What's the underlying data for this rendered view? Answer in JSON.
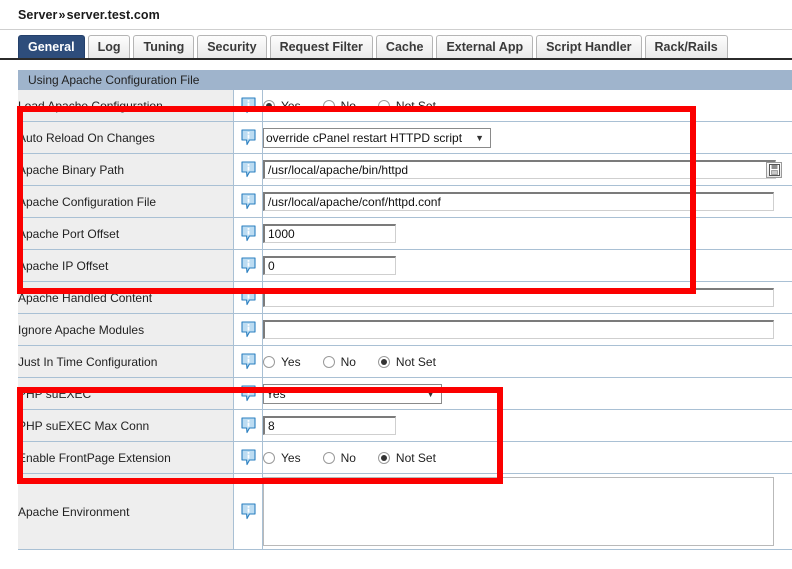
{
  "breadcrumb": {
    "root": "Server",
    "separator": "»",
    "current": "server.test.com"
  },
  "tabs": [
    {
      "label": "General",
      "active": true
    },
    {
      "label": "Log",
      "active": false
    },
    {
      "label": "Tuning",
      "active": false
    },
    {
      "label": "Security",
      "active": false
    },
    {
      "label": "Request Filter",
      "active": false
    },
    {
      "label": "Cache",
      "active": false
    },
    {
      "label": "External App",
      "active": false
    },
    {
      "label": "Script Handler",
      "active": false
    },
    {
      "label": "Rack/Rails",
      "active": false
    }
  ],
  "section": {
    "title": "Using Apache Configuration File"
  },
  "rows": {
    "load_apache_configuration": {
      "label": "Load Apache Configuration",
      "options": [
        "Yes",
        "No",
        "Not Set"
      ],
      "selected": "Yes"
    },
    "auto_reload_on_changes": {
      "label": "Auto Reload On Changes",
      "value": "override cPanel restart HTTPD script"
    },
    "apache_binary_path": {
      "label": "Apache Binary Path",
      "value": "/usr/local/apache/bin/httpd",
      "browse_icon": "file-picker-icon"
    },
    "apache_configuration_file": {
      "label": "Apache Configuration File",
      "value": "/usr/local/apache/conf/httpd.conf"
    },
    "apache_port_offset": {
      "label": "Apache Port Offset",
      "value": "1000"
    },
    "apache_ip_offset": {
      "label": "Apache IP Offset",
      "value": "0"
    },
    "apache_handled_content": {
      "label": "Apache Handled Content",
      "value": ""
    },
    "ignore_apache_modules": {
      "label": "Ignore Apache Modules",
      "value": ""
    },
    "just_in_time_configuration": {
      "label": "Just In Time Configuration",
      "options": [
        "Yes",
        "No",
        "Not Set"
      ],
      "selected": "Not Set"
    },
    "php_suexec": {
      "label": "PHP suEXEC",
      "value": "Yes"
    },
    "php_suexec_max_conn": {
      "label": "PHP suEXEC Max Conn",
      "value": "8"
    },
    "enable_frontpage_extension": {
      "label": "Enable FrontPage Extension",
      "options": [
        "Yes",
        "No",
        "Not Set"
      ],
      "selected": "Not Set"
    },
    "apache_environment": {
      "label": "Apache Environment",
      "value": ""
    }
  },
  "icons": {
    "info": "info-bubble-icon"
  },
  "colors": {
    "accent_tab": "#2e4d7b",
    "section_header": "#9fb4cc",
    "annotation": "#fb0000",
    "row_border": "#a9c0d4",
    "label_bg": "#eeeeee"
  }
}
